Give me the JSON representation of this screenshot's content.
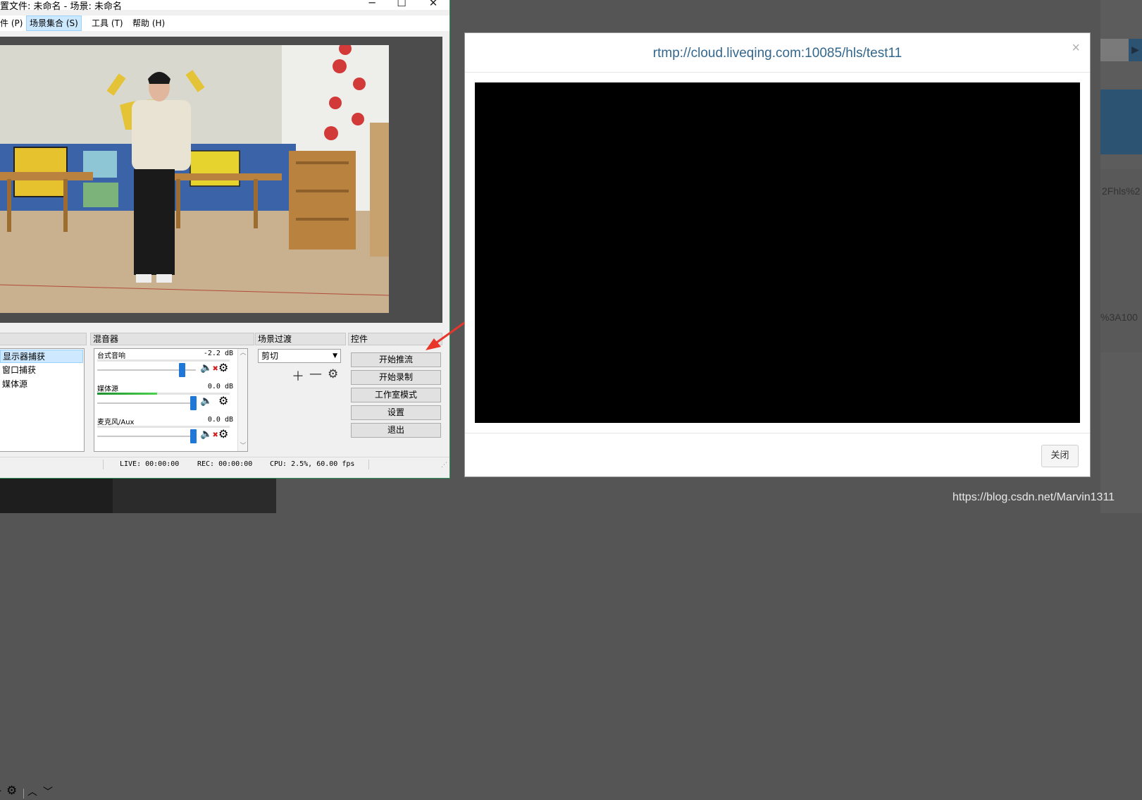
{
  "obs": {
    "title": "置文件: 未命名 - 场景: 未命名",
    "menus": [
      "件 (P)",
      "场景集合 (S)",
      "工具 (T)",
      "帮助 (H)"
    ],
    "docks": {
      "sources": "",
      "mixer": "混音器",
      "transitions": "场景过渡",
      "controls": "控件"
    },
    "sources": [
      "显示器捕获",
      "窗口捕获",
      "媒体源"
    ],
    "mixer": [
      {
        "name": "台式音响",
        "db": "-2.2 dB",
        "muted": true,
        "level": 0.0,
        "volume": 0.88
      },
      {
        "name": "媒体源",
        "db": "0.0 dB",
        "muted": false,
        "level": 0.45,
        "volume": 1.0
      },
      {
        "name": "麦克风/Aux",
        "db": "0.0 dB",
        "muted": true,
        "level": 0.0,
        "volume": 1.0
      }
    ],
    "transition": "剪切",
    "controls": [
      "开始推流",
      "开始录制",
      "工作室模式",
      "设置",
      "退出"
    ],
    "status": {
      "live": "LIVE: 00:00:00",
      "rec": "REC: 00:00:00",
      "cpu": "CPU: 2.5%, 60.00 fps"
    }
  },
  "modal": {
    "title": "rtmp://cloud.liveqing.com:10085/hls/test11",
    "close_label": "关闭"
  },
  "background": {
    "fragment_1": "2Fhls%2",
    "fragment_2": "%3A100",
    "watermark": "https://blog.csdn.net/Marvin1311"
  },
  "colors": {
    "accent": "#1f77d8",
    "modal_title": "#33678c",
    "arrow": "#e8362b"
  }
}
